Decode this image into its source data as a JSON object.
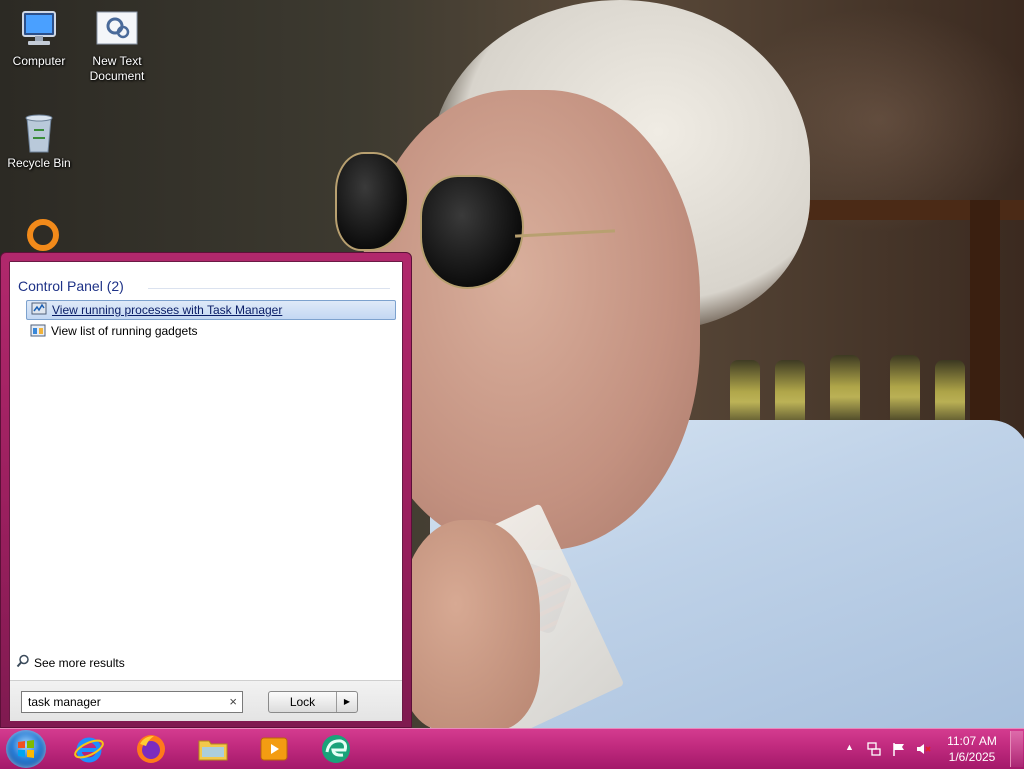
{
  "desktop": {
    "icons": [
      {
        "label_line1": "Computer",
        "label_line2": ""
      },
      {
        "label_line1": "New Text",
        "label_line2": "Document"
      },
      {
        "label_line1": "Recycle Bin",
        "label_line2": ""
      }
    ]
  },
  "start_menu": {
    "category": "Control Panel (2)",
    "results": [
      {
        "label": "View running processes with Task Manager",
        "icon": "task-manager-icon",
        "selected": true
      },
      {
        "label": "View list of running gadgets",
        "icon": "gadgets-icon",
        "selected": false
      }
    ],
    "see_more": "See more results",
    "search": {
      "value": "task manager",
      "clear_glyph": "×"
    },
    "lock_button": {
      "label": "Lock",
      "arrow": "▶"
    }
  },
  "taskbar": {
    "apps": [
      "internet-explorer-icon",
      "firefox-icon",
      "file-explorer-icon",
      "media-player-icon",
      "edge-icon"
    ],
    "tray": {
      "overflow_glyph": "▲"
    },
    "clock": {
      "time": "11:07 AM",
      "date": "1/6/2025"
    }
  },
  "colors": {
    "taskbar": "#c02a7e",
    "start_menu_frame": "#9a1f5e",
    "category_text": "#1e3287",
    "selection": "#c3d8f3"
  }
}
